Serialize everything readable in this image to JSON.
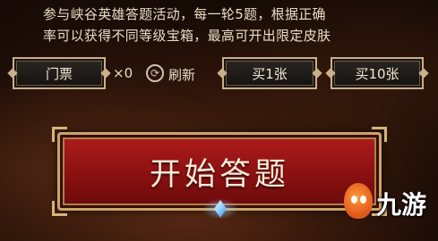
{
  "description": {
    "line1": "参与峡谷英雄答题活动，每一轮5题，根据正确",
    "line2": "率可以获得不同等级宝箱，最高可开出限定皮肤"
  },
  "toolbar": {
    "ticket_label": "门票",
    "ticket_count": "×0",
    "refresh_label": "刷新",
    "buy1_label": "买1张",
    "buy10_label": "买10张"
  },
  "start": {
    "label": "开始答题"
  },
  "watermark": {
    "logo_text": "九游"
  },
  "colors": {
    "accent_red": "#9a1414",
    "gold_frame": "#c9a56a",
    "text_light": "#e9dcc5"
  }
}
